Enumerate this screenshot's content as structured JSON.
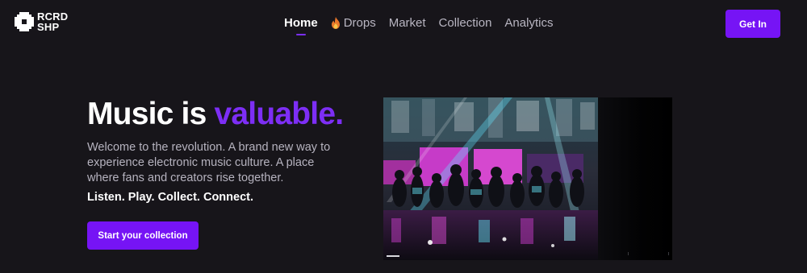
{
  "brand": {
    "line1": "RCRD",
    "line2": "SHP",
    "icon": "pixel-blob-logo"
  },
  "nav": {
    "items": [
      {
        "label": "Home",
        "active": true
      },
      {
        "label": "Drops",
        "icon": "fire-icon"
      },
      {
        "label": "Market"
      },
      {
        "label": "Collection"
      },
      {
        "label": "Analytics"
      }
    ]
  },
  "header": {
    "cta_label": "Get In"
  },
  "hero": {
    "title_main": "Music is ",
    "title_accent": "valuable.",
    "description": "Welcome to the revolution. A brand new way to experience electronic music culture. A place where fans and creators rise together.",
    "tagline": "Listen. Play. Collect. Connect.",
    "cta_label": "Start your collection"
  },
  "colors": {
    "accent": "#7614f5",
    "accent_text": "#7d2ef5",
    "background": "#17151a",
    "muted_text": "#b6b3bf"
  },
  "media": {
    "subject": "crowd-dancing-neon-club-video"
  }
}
